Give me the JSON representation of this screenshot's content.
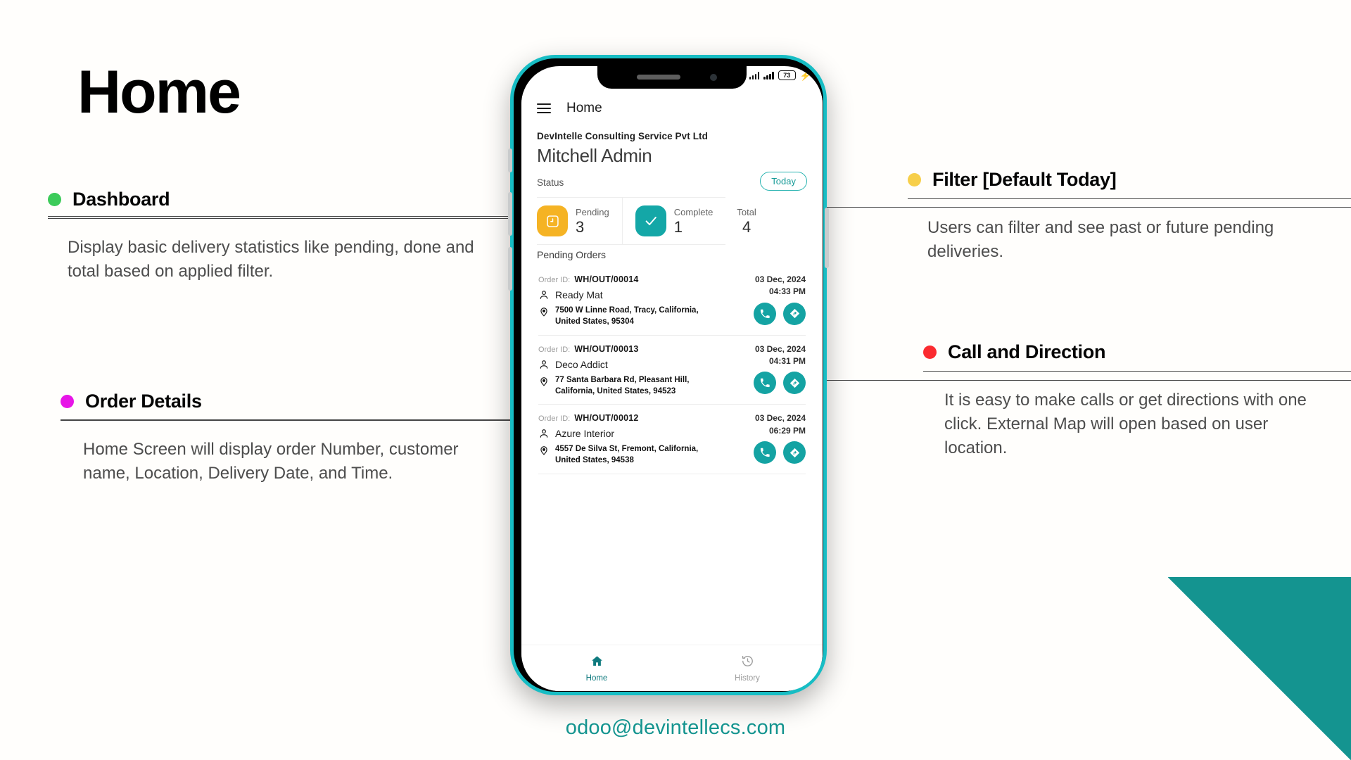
{
  "slide": {
    "title": "Home",
    "footer_email": "odoo@devintellecs.com",
    "accent_teal": "#14948f"
  },
  "annotations": [
    {
      "id": "dashboard",
      "dot_color": "#3ccb5a",
      "title": "Dashboard",
      "body": "Display basic delivery statistics like pending, done and total based on applied filter."
    },
    {
      "id": "order-details",
      "dot_color": "#e715e7",
      "title": "Order Details",
      "body": "Home Screen will display order Number, customer name, Location, Delivery Date, and Time."
    },
    {
      "id": "filter",
      "dot_color": "#f7cf4a",
      "title": "Filter [Default Today]",
      "body": "Users can filter and see past or future pending deliveries."
    },
    {
      "id": "call-direction",
      "dot_color": "#fb2b30",
      "title": "Call and Direction",
      "body": "It is easy to make calls or get directions with one click. External Map will open based on user location."
    }
  ],
  "phone": {
    "statusbar": {
      "battery": "73",
      "charging_icon": "bolt-icon"
    },
    "header": {
      "menu_icon": "hamburger-icon",
      "title": "Home"
    },
    "company": "DevIntelle Consulting Service Pvt Ltd",
    "username": "Mitchell Admin",
    "status_section": {
      "label": "Status",
      "filter_chip": "Today",
      "cards": [
        {
          "key": "Pending",
          "value": "3",
          "icon": "clock-icon",
          "color": "#f5b324"
        },
        {
          "key": "Complete",
          "value": "1",
          "icon": "check-icon",
          "color": "#14a7a7"
        },
        {
          "key": "Total",
          "value": "4",
          "icon": "",
          "color": ""
        }
      ]
    },
    "pending_orders_title": "Pending Orders",
    "orders": [
      {
        "order_id_label": "Order ID:",
        "order_id": "WH/OUT/00014",
        "customer": "Ready Mat",
        "address": "7500 W Linne Road, Tracy, California, United States, 95304",
        "date": "03 Dec, 2024",
        "time": "04:33 PM",
        "call_label": "phone-icon",
        "directions_label": "directions-icon"
      },
      {
        "order_id_label": "Order ID:",
        "order_id": "WH/OUT/00013",
        "customer": "Deco Addict",
        "address": "77 Santa Barbara Rd, Pleasant Hill, California, United States, 94523",
        "date": "03 Dec, 2024",
        "time": "04:31 PM",
        "call_label": "phone-icon",
        "directions_label": "directions-icon"
      },
      {
        "order_id_label": "Order ID:",
        "order_id": "WH/OUT/00012",
        "customer": "Azure Interior",
        "address": "4557 De Silva St, Fremont, California, United States, 94538",
        "date": "03 Dec, 2024",
        "time": "06:29 PM",
        "call_label": "phone-icon",
        "directions_label": "directions-icon"
      }
    ],
    "bottom_nav": [
      {
        "label": "Home",
        "icon": "home-icon",
        "active": true
      },
      {
        "label": "History",
        "icon": "history-icon",
        "active": false
      }
    ]
  }
}
